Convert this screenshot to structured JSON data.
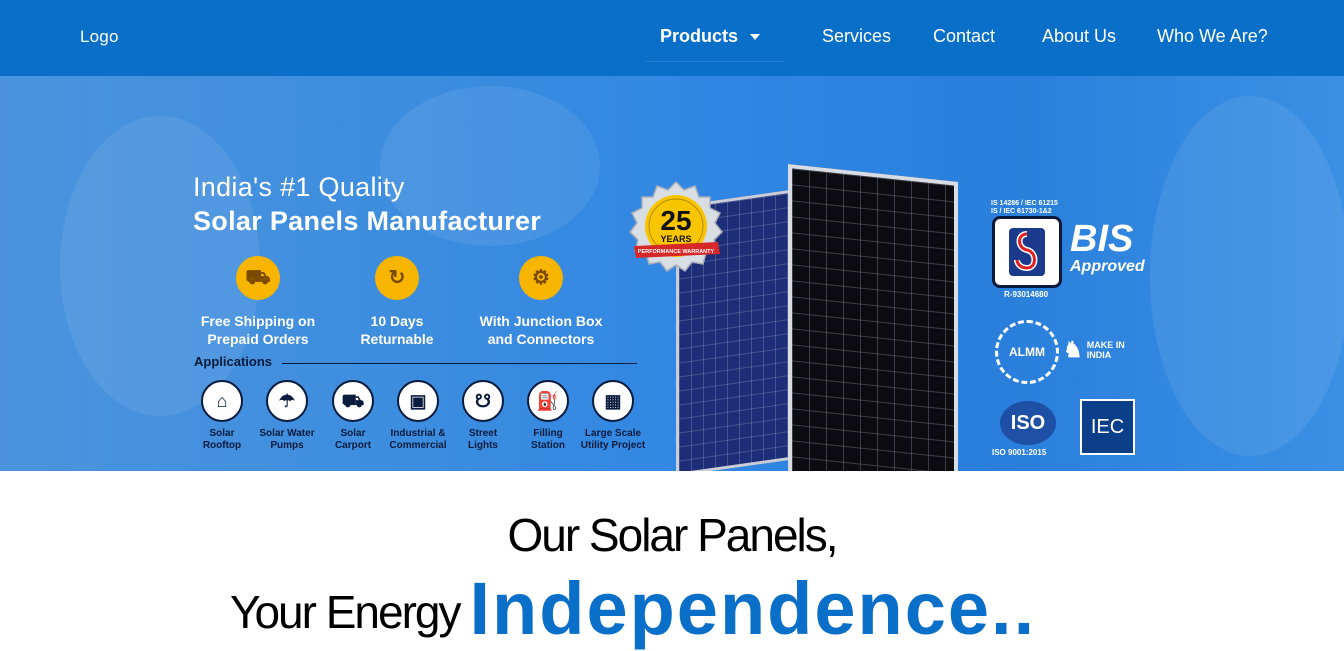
{
  "nav": {
    "logo": "Logo",
    "items": [
      {
        "label": "Products"
      },
      {
        "label": "Services"
      },
      {
        "label": "Contact"
      },
      {
        "label": "About Us"
      },
      {
        "label": "Who We Are?"
      }
    ]
  },
  "hero": {
    "title_line1": "India's #1 Quality",
    "title_line2": "Solar Panels Manufacturer",
    "features": [
      {
        "line1": "Free Shipping on",
        "line2": "Prepaid Orders",
        "icon": "truck-icon"
      },
      {
        "line1": "10 Days",
        "line2": "Returnable",
        "icon": "return-icon"
      },
      {
        "line1": "With Junction Box",
        "line2": "and Connectors",
        "icon": "junction-box-icon"
      }
    ],
    "applications_label": "Applications",
    "applications": [
      {
        "line1": "Solar",
        "line2": "Rooftop"
      },
      {
        "line1": "Solar Water",
        "line2": "Pumps"
      },
      {
        "line1": "Solar",
        "line2": "Carport"
      },
      {
        "line1": "Industrial &",
        "line2": "Commercial"
      },
      {
        "line1": "Street",
        "line2": "Lights"
      },
      {
        "line1": "Filling",
        "line2": "Station"
      },
      {
        "line1": "Large Scale",
        "line2": "Utility Project"
      }
    ],
    "badge": {
      "number": "25",
      "unit": "YEARS",
      "ribbon": "PERFORMANCE WARRANTY"
    },
    "certs": {
      "bis_standards_1": "IS 14286 / IEC 61215",
      "bis_standards_2": "IS / IEC 61730-1&2",
      "bis": "BIS",
      "bis_approved": "Approved",
      "bis_number": "R-93014680",
      "almm": "ALMM",
      "make_in_india": "MAKE IN INDIA",
      "iso": "ISO",
      "iso_sub": "ISO 9001:2015",
      "iec": "IEC"
    }
  },
  "headline": {
    "line1": "Our Solar Panels,",
    "line2_prefix": "Your Energy",
    "line2_accent": "Independence.."
  }
}
